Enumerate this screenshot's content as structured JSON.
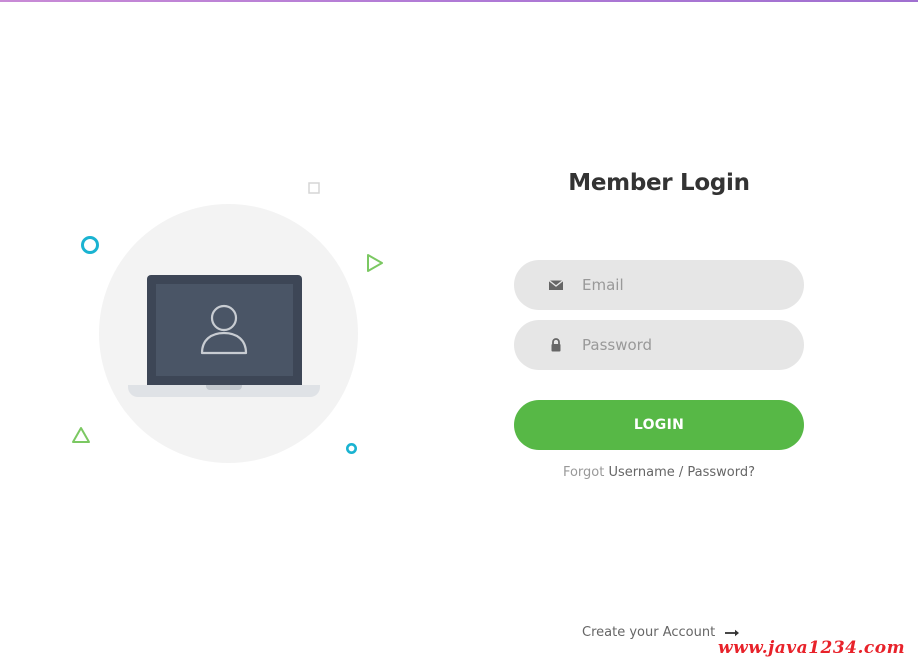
{
  "illustration": {
    "icons": [
      "laptop-icon",
      "user-icon",
      "square-icon",
      "circle-icon",
      "triangle-icon",
      "play-triangle-icon",
      "small-circle-icon"
    ]
  },
  "form": {
    "title": "Member Login",
    "email_placeholder": "Email",
    "password_placeholder": "Password",
    "login_label": "LOGIN",
    "forgot_prefix": "Forgot",
    "forgot_link": "Username / Password?",
    "create_account_label": "Create your Account"
  },
  "watermark": "www.java1234.com",
  "colors": {
    "accent_green": "#57b846",
    "input_bg": "#e6e6e6",
    "deco_cyan": "#1ab3d1",
    "deco_green": "#7bc862",
    "watermark_red": "#e8222a"
  }
}
